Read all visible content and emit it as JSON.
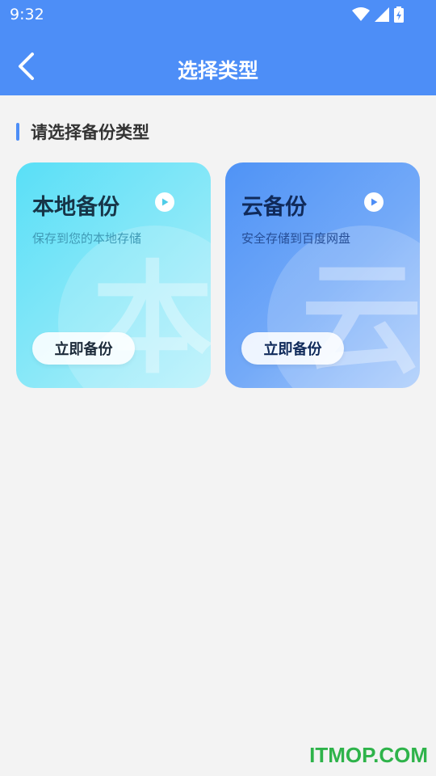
{
  "status_bar": {
    "time": "9:32"
  },
  "header": {
    "title": "选择类型",
    "back_icon": "chevron-left-icon"
  },
  "section": {
    "title": "请选择备份类型",
    "accent_color": "#4d8ef7"
  },
  "cards": [
    {
      "title": "本地备份",
      "description": "保存到您的本地存储",
      "background_char": "本",
      "button_label": "立即备份",
      "play_icon": "play-icon"
    },
    {
      "title": "云备份",
      "description": "安全存储到百度网盘",
      "background_char": "云",
      "button_label": "立即备份",
      "play_icon": "play-icon"
    }
  ],
  "watermark": "ITMOP.COM",
  "colors": {
    "primary": "#4d8ef7",
    "local_card": "#59dff7",
    "cloud_card": "#4f93f6",
    "background": "#f3f3f3",
    "watermark": "#2eb34a"
  }
}
